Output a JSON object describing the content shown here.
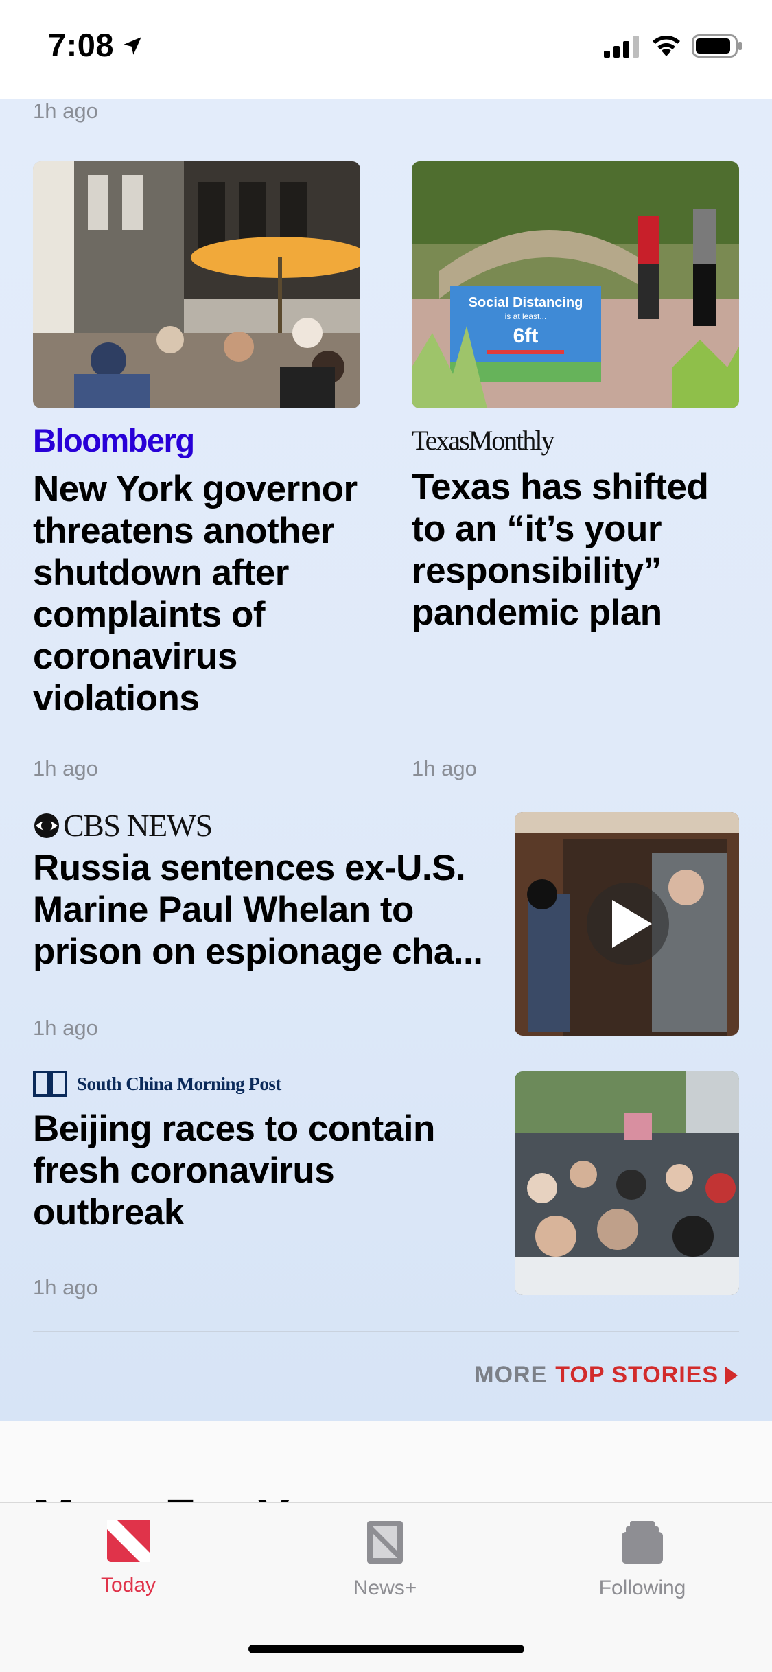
{
  "status_bar": {
    "time": "7:08"
  },
  "feed": {
    "top_timestamp": "1h ago",
    "stories": [
      {
        "publisher": "Bloomberg",
        "headline_lines": [
          "New York governor",
          "threatens another",
          "shutdown after",
          "complaints of",
          "coronavirus",
          "violations"
        ],
        "timestamp": "1h ago"
      },
      {
        "publisher": "TexasMonthly",
        "headline_lines": [
          "Texas has shifted",
          "to an “it’s your",
          "responsibility”",
          "pandemic plan"
        ],
        "timestamp": "1h ago",
        "image_sign": {
          "title": "Social Distancing",
          "subtitle": "is at least...",
          "distance": "6ft"
        }
      },
      {
        "publisher": "CBS NEWS",
        "headline_lines": [
          "Russia sentences ex-U.S.",
          "Marine Paul Whelan to",
          "prison on espionage cha..."
        ],
        "timestamp": "1h ago"
      },
      {
        "publisher": "South China Morning Post",
        "headline_lines": [
          "Beijing races to contain",
          "fresh coronavirus",
          "outbreak"
        ],
        "timestamp": "1h ago"
      }
    ],
    "more_link": {
      "prefix": "MORE",
      "label": "TOP STORIES"
    }
  },
  "next_section": {
    "heading": "More For You"
  },
  "tab_bar": {
    "tabs": [
      {
        "label": "Today",
        "icon": "news-logo-icon",
        "active": true
      },
      {
        "label": "News+",
        "icon": "news-plus-icon",
        "active": false
      },
      {
        "label": "Following",
        "icon": "following-stack-icon",
        "active": false
      }
    ]
  },
  "colors": {
    "accent_red": "#d22b2b",
    "tab_active": "#e0334a",
    "tab_inactive": "#8e8e93",
    "bloomberg_blue": "#2800d7"
  }
}
